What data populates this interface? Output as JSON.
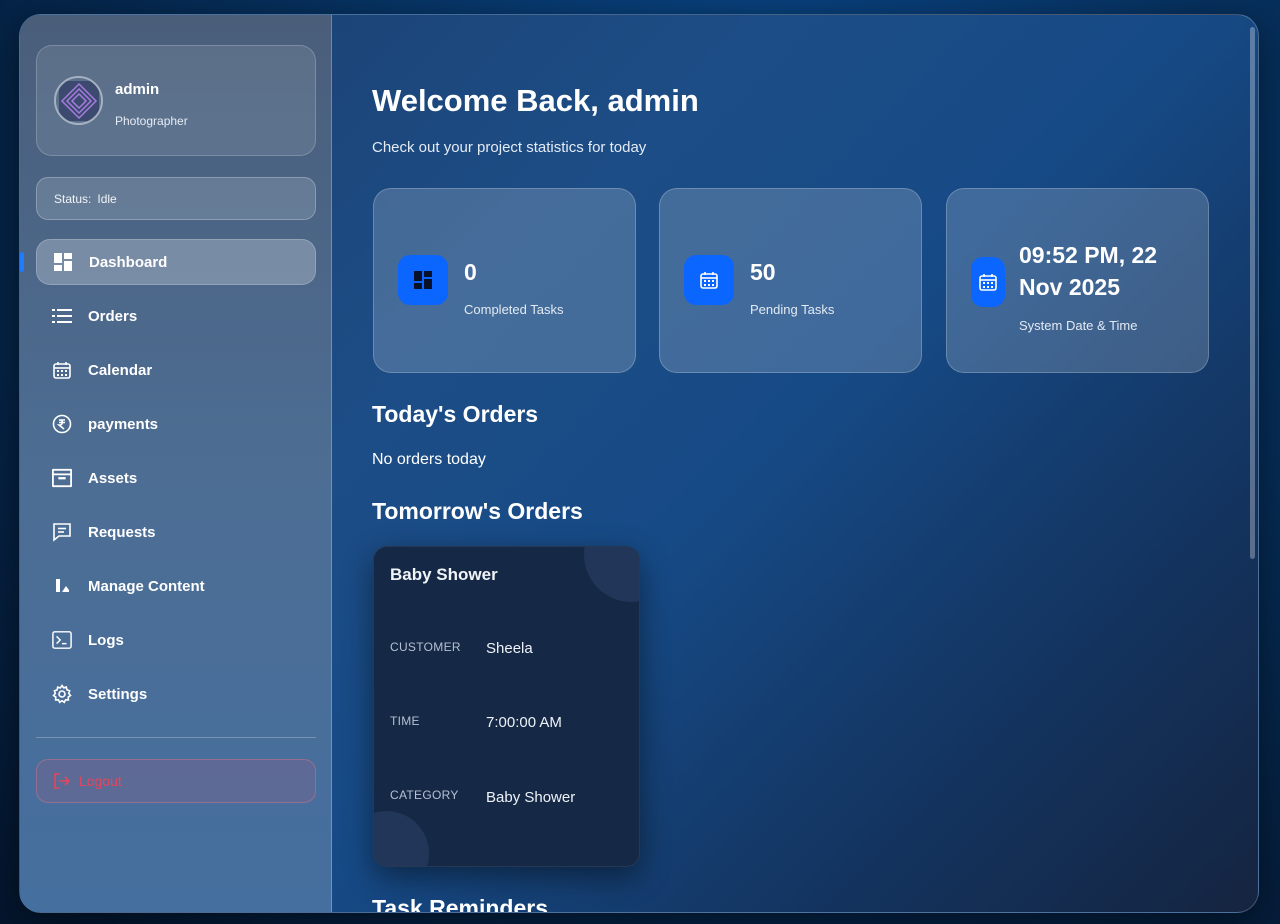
{
  "profile": {
    "name": "admin",
    "role": "Photographer"
  },
  "status": {
    "label": "Status:",
    "value": "Idle"
  },
  "nav": [
    {
      "label": "Dashboard",
      "icon": "dashboard-icon"
    },
    {
      "label": "Orders",
      "icon": "list-icon"
    },
    {
      "label": "Calendar",
      "icon": "calendar-icon"
    },
    {
      "label": "payments",
      "icon": "rupee-icon"
    },
    {
      "label": "Assets",
      "icon": "archive-icon"
    },
    {
      "label": "Requests",
      "icon": "message-icon"
    },
    {
      "label": "Manage Content",
      "icon": "content-icon"
    },
    {
      "label": "Logs",
      "icon": "terminal-icon"
    },
    {
      "label": "Settings",
      "icon": "gear-icon"
    }
  ],
  "logout_label": "Logout",
  "main": {
    "title": "Welcome Back, admin",
    "subtitle": "Check out your project statistics for today",
    "stats": [
      {
        "value": "0",
        "label": "Completed Tasks",
        "icon": "dashboard-icon"
      },
      {
        "value": "50",
        "label": "Pending Tasks",
        "icon": "calendar-icon"
      },
      {
        "value": "09:52 PM, 22 Nov 2025",
        "label": "System Date & Time",
        "icon": "calendar-icon"
      }
    ],
    "today_heading": "Today's Orders",
    "today_empty": "No orders today",
    "tomorrow_heading": "Tomorrow's Orders",
    "tomorrow_orders": [
      {
        "title": "Baby Shower",
        "customer_label": "CUSTOMER",
        "customer": "Sheela",
        "time_label": "TIME",
        "time": "7:00:00 AM",
        "category_label": "CATEGORY",
        "category": "Baby Shower"
      }
    ],
    "reminders_heading": "Task Reminders"
  },
  "colors": {
    "accent": "#0a66ff",
    "logout": "#e6455c"
  }
}
